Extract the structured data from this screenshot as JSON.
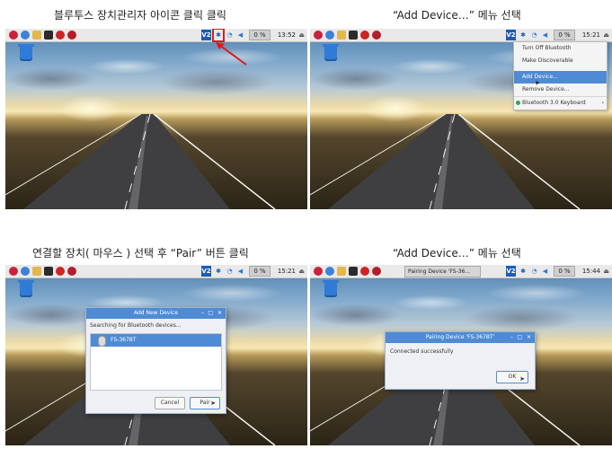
{
  "captions": {
    "c1": "블루투스 장치관리자 아이콘 클릭 클릭",
    "c2": "“Add Device…” 메뉴 선택",
    "c3": "연결할 장치( 마우스 ) 선택 후 “Pair” 버튼 클릭",
    "c4": "“Add Device…” 메뉴 선택"
  },
  "panels": [
    {
      "clock": "13:52",
      "volume_indicator": "0 %"
    },
    {
      "clock": "15:21",
      "volume_indicator": "0 %",
      "menu": {
        "items": [
          "Turn Off Bluetooth",
          "Make Discoverable",
          "Add Device...",
          "Remove Device...",
          "Bluetooth 3.0 Keyboard"
        ],
        "selected_index": 2
      }
    },
    {
      "clock": "15:21",
      "volume_indicator": "0 %",
      "dialog": {
        "title": "Add New Device",
        "status": "Searching for Bluetooth devices...",
        "device": "FS-367BT",
        "cancel": "Cancel",
        "pair": "Pair"
      }
    },
    {
      "clock": "15:44",
      "volume_indicator": "0 %",
      "taskbar_window": "Pairing Device 'FS-36...",
      "dialog": {
        "title": "Pairing Device 'FS-367BT'",
        "message": "Connected successfully",
        "ok": "OK"
      }
    }
  ],
  "taskbar_vnc_label": "V2",
  "colors": {
    "accent": "#4f8bd5",
    "highlight": "#e01a1a"
  }
}
